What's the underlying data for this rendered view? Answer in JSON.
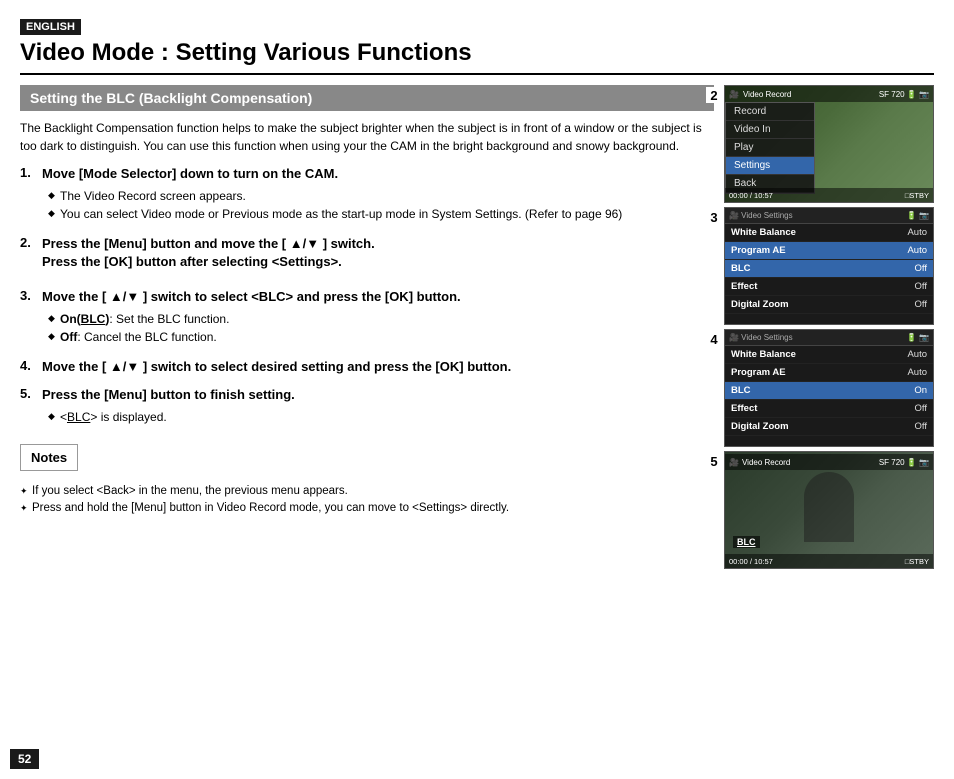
{
  "page": {
    "english_tag": "ENGLISH",
    "main_title": "Video Mode : Setting Various Functions",
    "section_heading": "Setting the BLC (Backlight Compensation)",
    "page_number": "52",
    "intro_text": "The Backlight Compensation function helps to make the subject brighter when the subject is in front of a window or the subject is too dark to distinguish. You can use this function when using your the CAM in the bright background and snowy background.",
    "steps": [
      {
        "number": "1.",
        "title": "Move [Mode Selector] down to turn on the CAM.",
        "bullets": [
          "The Video Record screen appears.",
          "You can select Video mode or Previous mode as the start-up mode in System Settings. (Refer to page 96)"
        ]
      },
      {
        "number": "2.",
        "title": "Press the [Menu] button and move the [ ▲/▼ ] switch.\nPress the [OK] button after selecting <Settings>.",
        "bullets": []
      },
      {
        "number": "3.",
        "title": "Move the [ ▲/▼ ] switch to select <BLC> and press the [OK] button.",
        "bullets": [
          "On(BLC): Set the BLC function.",
          "Off: Cancel the BLC function."
        ]
      },
      {
        "number": "4.",
        "title": "Move the [ ▲/▼ ] switch to select desired setting and press the [OK] button.",
        "bullets": []
      },
      {
        "number": "5.",
        "title": "Press the [Menu] button to finish setting.",
        "bullets": [
          "<BLC> is displayed."
        ]
      }
    ],
    "notes_label": "Notes",
    "notes": [
      "If you select <Back> in the menu, the previous menu appears.",
      "Press and hold the [Menu] button in Video Record mode, you can move to <Settings> directly."
    ],
    "screens": [
      {
        "step_num": "2",
        "top_bar": "🎥 Video Record  SF  720  🔋  📷",
        "menu_items": [
          "Record",
          "Video In",
          "Play",
          "Settings",
          "Back"
        ],
        "selected_index": 3,
        "bottom": "00:00 / 10:57  □STBY"
      },
      {
        "step_num": "3",
        "top_bar": "🎥 Video Settings  🔋  📷",
        "title": "Video Settings",
        "rows": [
          {
            "label": "White Balance",
            "value": "Auto"
          },
          {
            "label": "Program AE",
            "value": "Auto",
            "highlight": true
          },
          {
            "label": "BLC",
            "value": "Off",
            "highlight": true
          },
          {
            "label": "Effect",
            "value": "Off"
          },
          {
            "label": "Digital Zoom",
            "value": "Off"
          }
        ]
      },
      {
        "step_num": "4",
        "top_bar": "🎥 Video Settings  🔋  📷",
        "title": "Video Settings",
        "rows": [
          {
            "label": "White Balance",
            "value": "Auto"
          },
          {
            "label": "Program AE",
            "value": "Auto"
          },
          {
            "label": "BLC",
            "value": "On",
            "highlight": true
          },
          {
            "label": "Effect",
            "value": "Off"
          },
          {
            "label": "Digital Zoom",
            "value": "Off"
          }
        ]
      },
      {
        "step_num": "5",
        "top_bar": "🎥 Video Record  SF  720  🔋  📷",
        "blc_text": "BLC",
        "bottom": "00:00 / 10:57  □STBY"
      }
    ]
  }
}
